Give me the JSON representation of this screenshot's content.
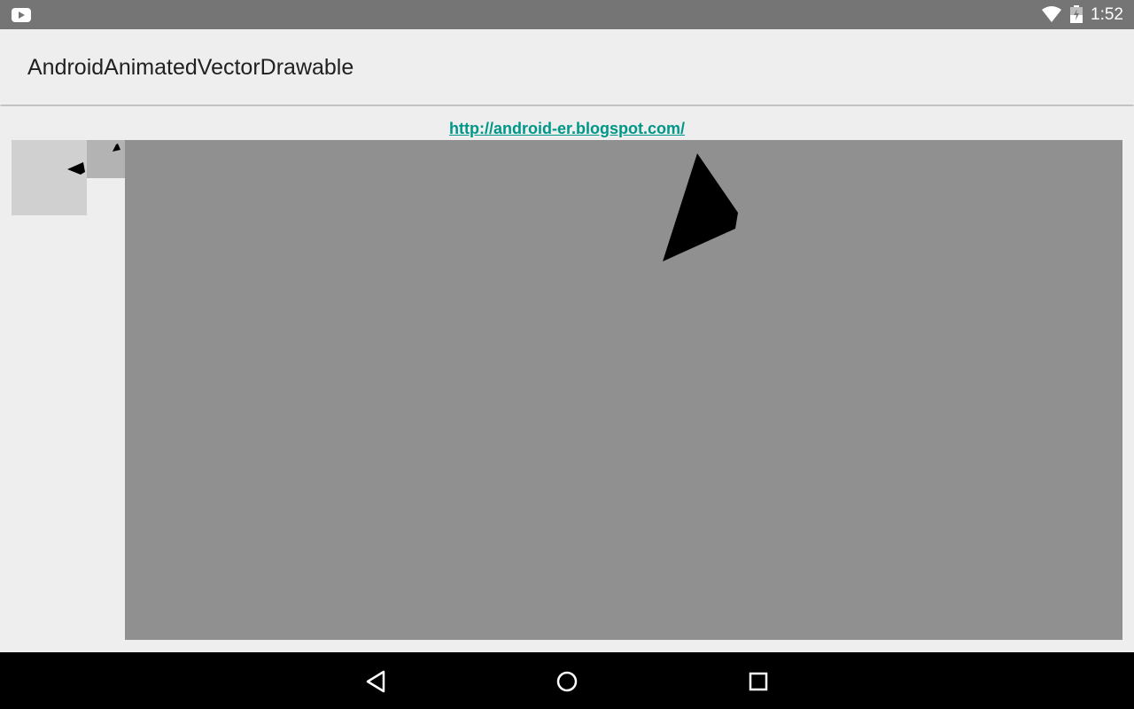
{
  "status_bar": {
    "notification_icon": "youtube-icon",
    "wifi_icon": "wifi-icon",
    "battery_icon": "battery-charging-icon",
    "time": "1:52"
  },
  "app_bar": {
    "title": "AndroidAnimatedVectorDrawable"
  },
  "content": {
    "link_text": "http://android-er.blogspot.com/",
    "images": [
      {
        "name": "image-view-small",
        "background": "#d0d0d0"
      },
      {
        "name": "image-view-medium",
        "background": "#b3b3b3"
      },
      {
        "name": "image-view-large",
        "background": "#909090"
      }
    ],
    "shape_color": "#000000"
  },
  "nav_bar": {
    "back_icon": "back-icon",
    "home_icon": "home-icon",
    "recents_icon": "recents-icon"
  },
  "colors": {
    "status_bar": "#757575",
    "app_bar": "#eeeeee",
    "link": "#009688",
    "nav_bar": "#000000"
  }
}
